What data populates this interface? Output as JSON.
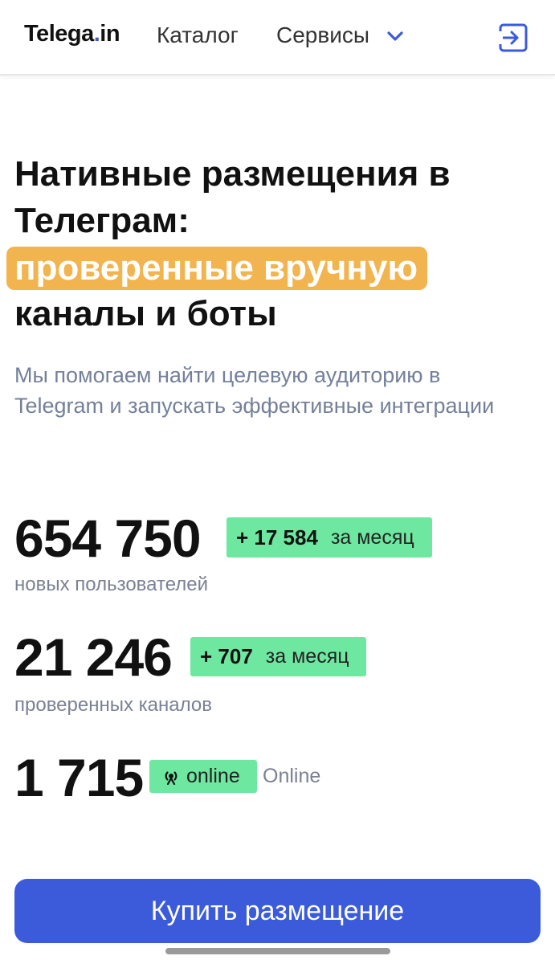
{
  "header": {
    "logo_main": "Telega",
    "logo_dot": ".",
    "logo_suffix": "in",
    "nav_catalog": "Каталог",
    "nav_services": "Сервисы",
    "services_icon": "chevron-down-icon",
    "login_icon": "login-icon",
    "accent_color": "#3b5bdb"
  },
  "hero": {
    "title_line1": "Нативные размещения в",
    "title_line2": "Телеграм:",
    "highlight": "проверенные вручную",
    "title_line4": "каналы и боты",
    "subtitle": "Мы помогаем найти целевую аудиторию в Telegram и запускать эффективные интеграции",
    "highlight_color": "#f2b44e"
  },
  "stats": {
    "users": {
      "value": "654 750",
      "delta": "+ 17 584",
      "period": "за месяц",
      "label": "новых пользователей"
    },
    "channels": {
      "value": "21 246",
      "delta": "+ 707",
      "period": "за месяц",
      "label": "проверенных каналов"
    },
    "online": {
      "value": "1 715",
      "badge_icon": "broadcast-icon",
      "badge_text": "online",
      "label": "Online"
    },
    "badge_color": "#6ee7a0"
  },
  "cta": {
    "buy_label": "Купить размещение"
  }
}
